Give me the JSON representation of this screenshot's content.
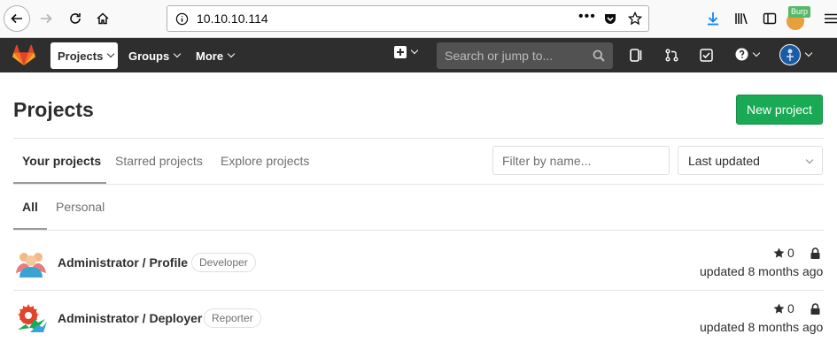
{
  "browser": {
    "url": "10.10.10.114",
    "extension_badge": "Burp"
  },
  "navbar": {
    "projects_label": "Projects",
    "groups_label": "Groups",
    "more_label": "More",
    "search_placeholder": "Search or jump to..."
  },
  "page": {
    "title": "Projects",
    "new_project_label": "New project",
    "tabs": [
      "Your projects",
      "Starred projects",
      "Explore projects"
    ],
    "filter_placeholder": "Filter by name...",
    "sort_value": "Last updated",
    "subtabs": [
      "All",
      "Personal"
    ]
  },
  "projects": [
    {
      "name": "Administrator / Profile",
      "role": "Developer",
      "stars": "0",
      "updated": "updated 8 months ago"
    },
    {
      "name": "Administrator / Deployer",
      "role": "Reporter",
      "stars": "0",
      "updated": "updated 8 months ago"
    }
  ],
  "colors": {
    "navbar": "#2e2e2e",
    "new_project": "#1aaa55",
    "gitlab_orange": "#e24329"
  }
}
